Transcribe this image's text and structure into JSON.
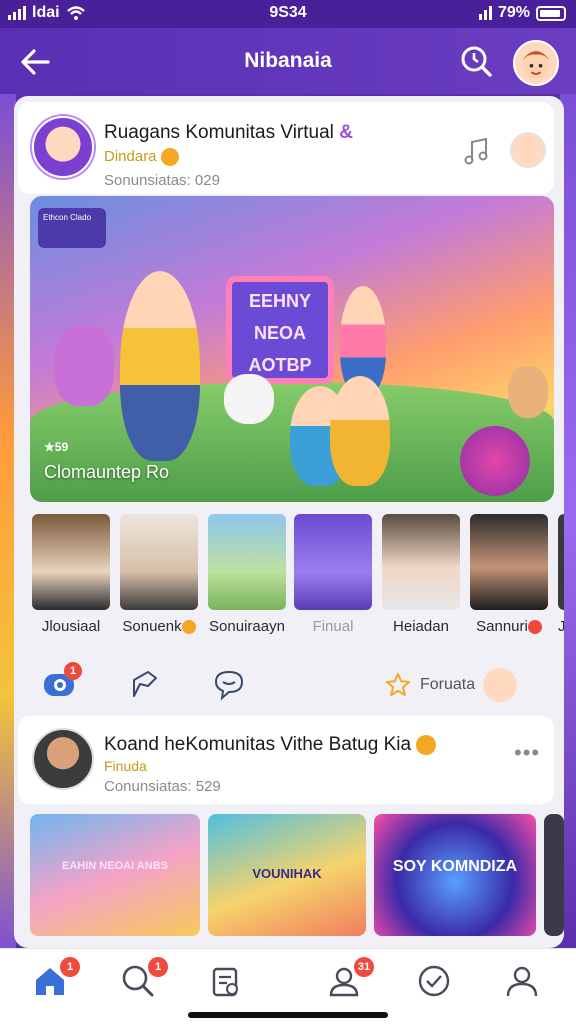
{
  "status_bar": {
    "carrier": "ldai",
    "time": "9S34",
    "battery": "79%"
  },
  "app_bar": {
    "title": "Nibanaia"
  },
  "post": {
    "name": "Ruagans Komunitas Virtual",
    "purple_mark": "&",
    "sub": "Dindara",
    "meta": "Sonunsiatas: 029"
  },
  "hero": {
    "badge": "Ethcon Clado",
    "board_lines": [
      "EEHNY",
      "NEOA",
      "AOTBP"
    ],
    "caption_small": "59",
    "caption": "Clomauntep Ro"
  },
  "thumbs": [
    {
      "label": "Jlousiaal"
    },
    {
      "label": "Sonuenk"
    },
    {
      "label": "Sonuiraayn"
    },
    {
      "label": "Finual"
    },
    {
      "label": "Heiadan"
    },
    {
      "label": "Sannuri"
    },
    {
      "label": "Ja"
    }
  ],
  "actions": {
    "like_badge": "1",
    "fav_label": "Foruata"
  },
  "post2": {
    "name": "Koand heKomunitas Vithe Batug Kia",
    "sub": "Finuda",
    "meta": "Conunsiatas: 529",
    "more": "•••"
  },
  "cards": [
    {
      "title": "EAHIN NEOAI ANBS"
    },
    {
      "title": "VOUNIHAK"
    },
    {
      "title": "SOY KOMNDIZA"
    }
  ],
  "bottom_nav": {
    "home_badge": "1",
    "search_badge": "1",
    "community_badge": "31"
  },
  "colors": {
    "header": "#5a2fb3",
    "badge": "#f0493e",
    "accent_gold": "#c79b16",
    "nav_active": "#3a6fd8"
  }
}
